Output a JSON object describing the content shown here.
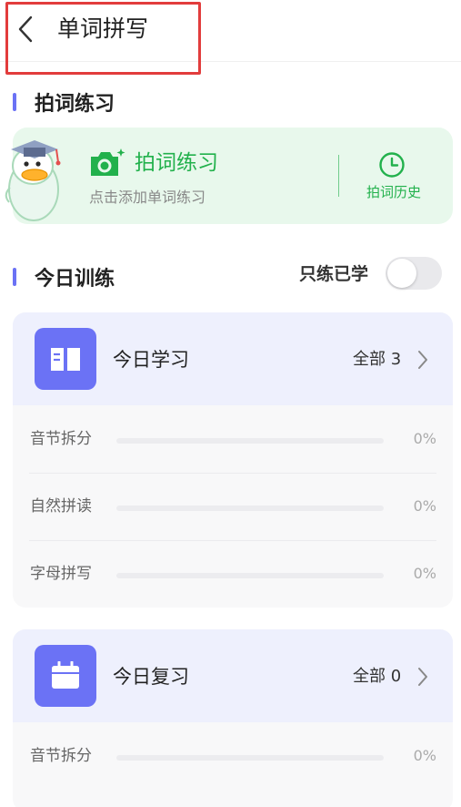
{
  "header": {
    "title": "单词拼写",
    "back_icon": "chevron-left-icon"
  },
  "photo_section": {
    "title": "拍词练习",
    "card": {
      "main_label": "拍词练习",
      "sub_label": "点击添加单词练习",
      "history_label": "拍词历史",
      "camera_icon": "camera-icon",
      "history_icon": "clock-icon",
      "mascot_icon": "duck-mascot-icon"
    }
  },
  "training_section": {
    "title": "今日训练",
    "toggle_label": "只练已学",
    "toggle_on": false
  },
  "study_card": {
    "title": "今日学习",
    "count_text": "全部 3",
    "icon": "book-icon",
    "rows": [
      {
        "label": "音节拆分",
        "progress_text": "0%",
        "progress": 0
      },
      {
        "label": "自然拼读",
        "progress_text": "0%",
        "progress": 0
      },
      {
        "label": "字母拼写",
        "progress_text": "0%",
        "progress": 0
      }
    ]
  },
  "review_card": {
    "title": "今日复习",
    "count_text": "全部 0",
    "icon": "calendar-icon",
    "rows": [
      {
        "label": "音节拆分",
        "progress_text": "0%",
        "progress": 0
      }
    ]
  },
  "colors": {
    "accent": "#6b72f5",
    "green": "#22b14c",
    "green_bg": "#e8f8ec",
    "card_head_bg": "#eef0fd",
    "highlight": "#e23c3c"
  }
}
